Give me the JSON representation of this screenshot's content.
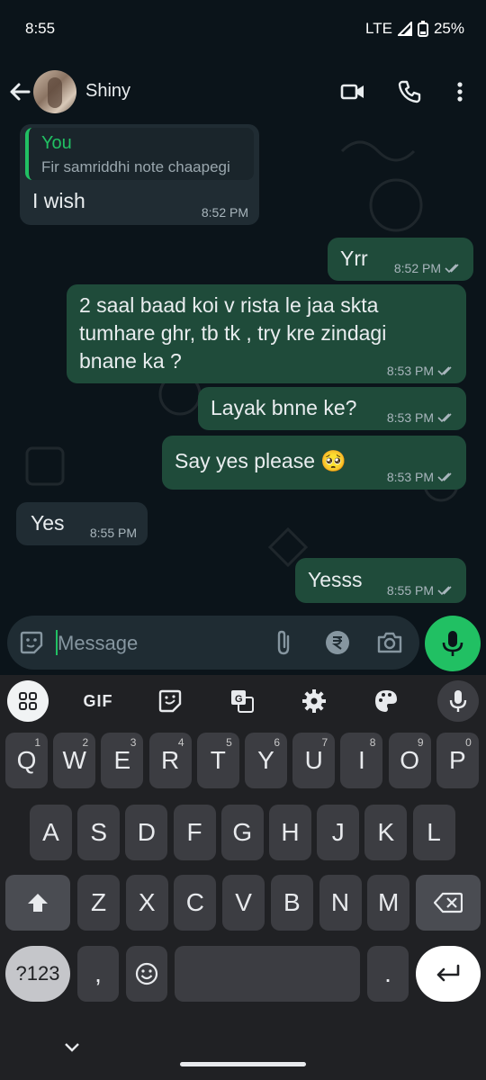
{
  "status_bar": {
    "time": "8:55",
    "network": "LTE",
    "battery": "25%"
  },
  "header": {
    "contact_name": "Shiny"
  },
  "messages": [
    {
      "direction": "in",
      "quote_author": "You",
      "quote_text": "Fir samriddhi note chaapegi",
      "text": "I wish",
      "time": "8:52 PM"
    },
    {
      "direction": "out",
      "text": "Yrr",
      "time": "8:52 PM"
    },
    {
      "direction": "out",
      "text_lines": [
        "2 saal baad koi v rista le jaa skta",
        "tumhare ghr, tb tk , try kre zindagi",
        "bnane ka ?"
      ],
      "time": "8:53 PM"
    },
    {
      "direction": "out",
      "text": "Layak bnne ke?",
      "time": "8:53 PM"
    },
    {
      "direction": "out",
      "text": "Say yes please 🥺",
      "time": "8:53 PM"
    },
    {
      "direction": "in",
      "text": "Yes",
      "time": "8:55 PM"
    },
    {
      "direction": "out",
      "text": "Yesss",
      "time": "8:55 PM"
    }
  ],
  "composer": {
    "placeholder": "Message"
  },
  "keyboard": {
    "toolbar": {
      "gif": "GIF"
    },
    "row1": [
      {
        "key": "Q",
        "hint": "1"
      },
      {
        "key": "W",
        "hint": "2"
      },
      {
        "key": "E",
        "hint": "3"
      },
      {
        "key": "R",
        "hint": "4"
      },
      {
        "key": "T",
        "hint": "5"
      },
      {
        "key": "Y",
        "hint": "6"
      },
      {
        "key": "U",
        "hint": "7"
      },
      {
        "key": "I",
        "hint": "8"
      },
      {
        "key": "O",
        "hint": "9"
      },
      {
        "key": "P",
        "hint": "0"
      }
    ],
    "row2": [
      "A",
      "S",
      "D",
      "F",
      "G",
      "H",
      "J",
      "K",
      "L"
    ],
    "row3": [
      "Z",
      "X",
      "C",
      "V",
      "B",
      "N",
      "M"
    ],
    "symbols_label": "?123",
    "comma": ",",
    "period": "."
  },
  "colors": {
    "accent": "#21c063",
    "outgoing_bubble": "#1f4b3a",
    "incoming_bubble": "#202c33",
    "background": "#0b141a"
  }
}
